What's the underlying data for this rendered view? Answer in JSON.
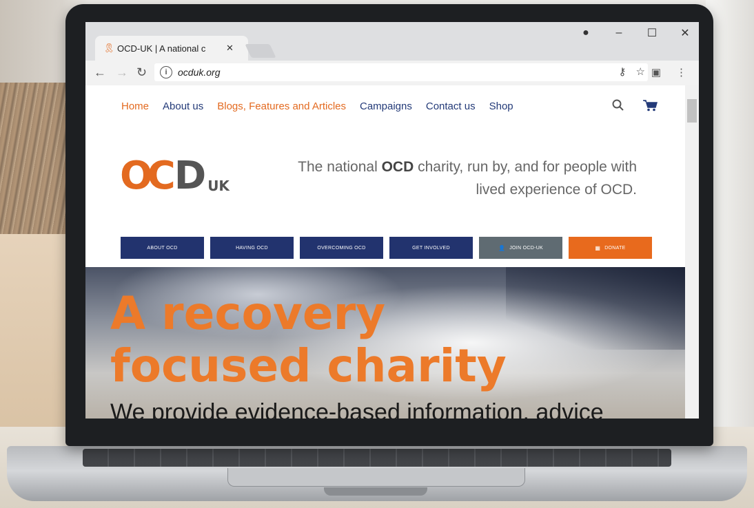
{
  "browser": {
    "tab_title": "OCD-UK | A national  c",
    "tab_close": "✕",
    "url": "ocduk.org",
    "window_controls": [
      "●",
      "–",
      "☐",
      "✕"
    ]
  },
  "site": {
    "nav": [
      {
        "label": "Home",
        "color": "orange"
      },
      {
        "label": "About us",
        "color": "blue"
      },
      {
        "label": "Blogs, Features and Articles",
        "color": "orange"
      },
      {
        "label": "Campaigns",
        "color": "blue"
      },
      {
        "label": "Contact us",
        "color": "blue"
      },
      {
        "label": "Shop",
        "color": "blue"
      }
    ],
    "logo": {
      "oc": "OC",
      "d": "D",
      "uk": "UK"
    },
    "tagline_pre": "The national ",
    "tagline_bold": "OCD",
    "tagline_post": " charity, run by, and for people with lived experience of OCD.",
    "buttons": {
      "about_ocd": "ABOUT OCD",
      "having_ocd": "HAVING OCD",
      "overcoming_ocd": "OVERCOMING OCD",
      "get_involved": "GET INVOLVED",
      "join": "JOIN OCD-UK",
      "donate": "DONATE"
    },
    "hero": {
      "title_line1": "A recovery",
      "title_line2": "focused charity",
      "subtitle": "We provide evidence-based information, advice"
    }
  },
  "colors": {
    "brand_orange": "#e36a20",
    "brand_navy": "#22336e",
    "join_grey": "#5f6b72"
  }
}
